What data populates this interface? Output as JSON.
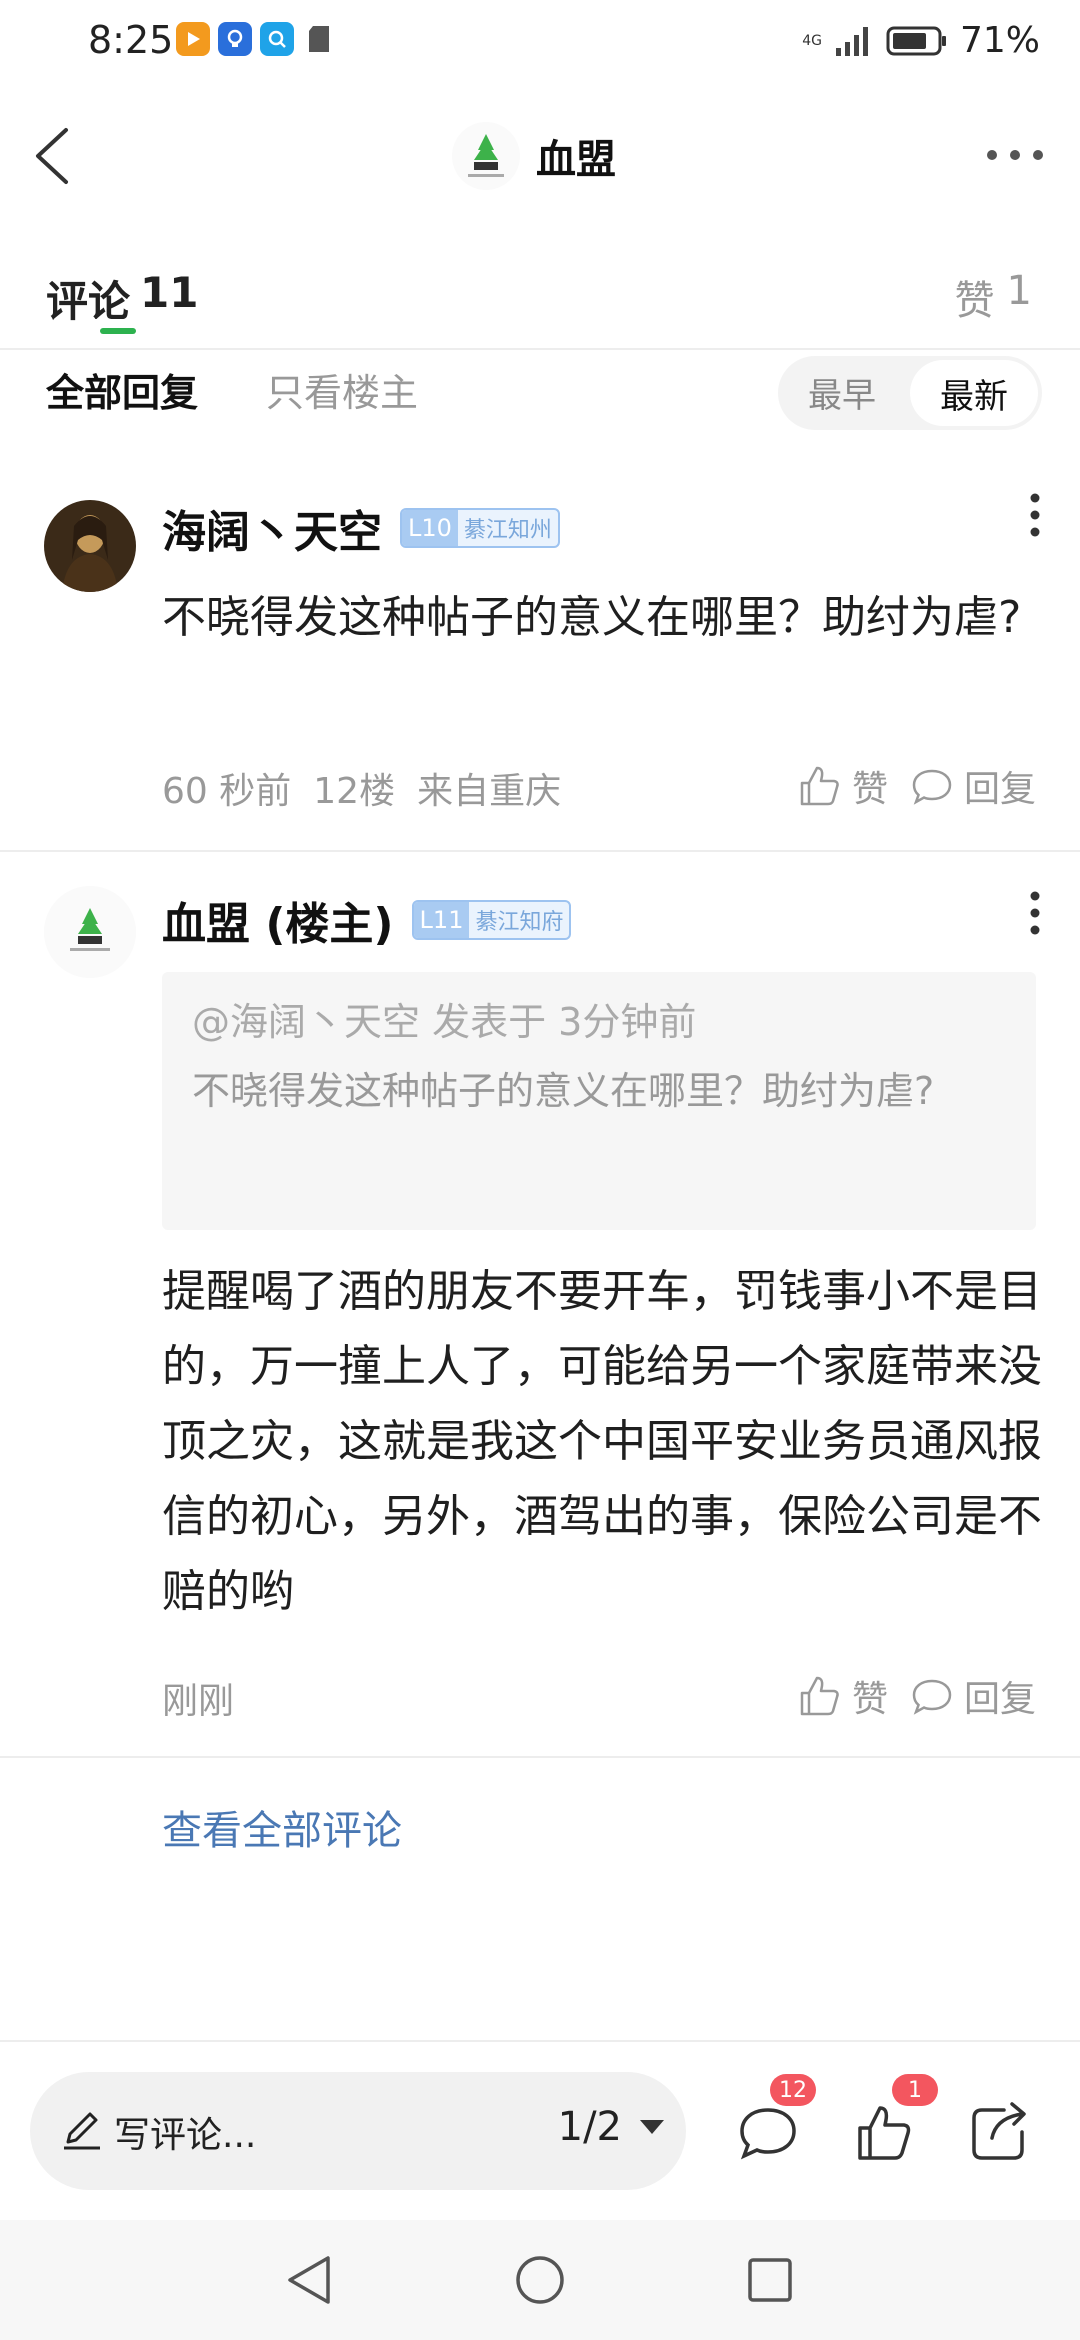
{
  "status_bar": {
    "time": "8:25",
    "network": "4G",
    "battery": "71%"
  },
  "header": {
    "title": "血盟"
  },
  "tabs": {
    "comments_label": "评论",
    "comments_count": "11",
    "likes_label": "赞",
    "likes_count": "1"
  },
  "filters": {
    "all": "全部回复",
    "owner_only": "只看楼主",
    "sort_oldest": "最早",
    "sort_newest": "最新"
  },
  "comments": [
    {
      "name": "海阔丶天空",
      "level": "L10",
      "title": "綦江知州",
      "text": "不晓得发这种帖子的意义在哪里？助纣为虐?",
      "time": "60 秒前",
      "floor": "12楼",
      "location": "来自重庆",
      "like_label": "赞",
      "reply_label": "回复"
    },
    {
      "name": "血盟 (楼主)",
      "level": "L11",
      "title": "綦江知府",
      "quote_header": "@海阔丶天空 发表于 3分钟前",
      "quote_text": "不晓得发这种帖子的意义在哪里？助纣为虐?",
      "text": "提醒喝了酒的朋友不要开车，罚钱事小不是目的，万一撞上人了，可能给另一个家庭带来没顶之灾，这就是我这个中国平安业务员通风报信的初心，另外，酒驾出的事，保险公司是不赔的哟",
      "time": "刚刚",
      "like_label": "赞",
      "reply_label": "回复"
    }
  ],
  "view_all": "查看全部评论",
  "bottom_bar": {
    "write_placeholder": "写评论...",
    "page_indicator": "1/2",
    "comment_badge": "12",
    "like_badge": "1"
  },
  "colors": {
    "accent_green": "#2db24f",
    "link_blue": "#4a78b4",
    "badge_red": "#f3565f"
  }
}
